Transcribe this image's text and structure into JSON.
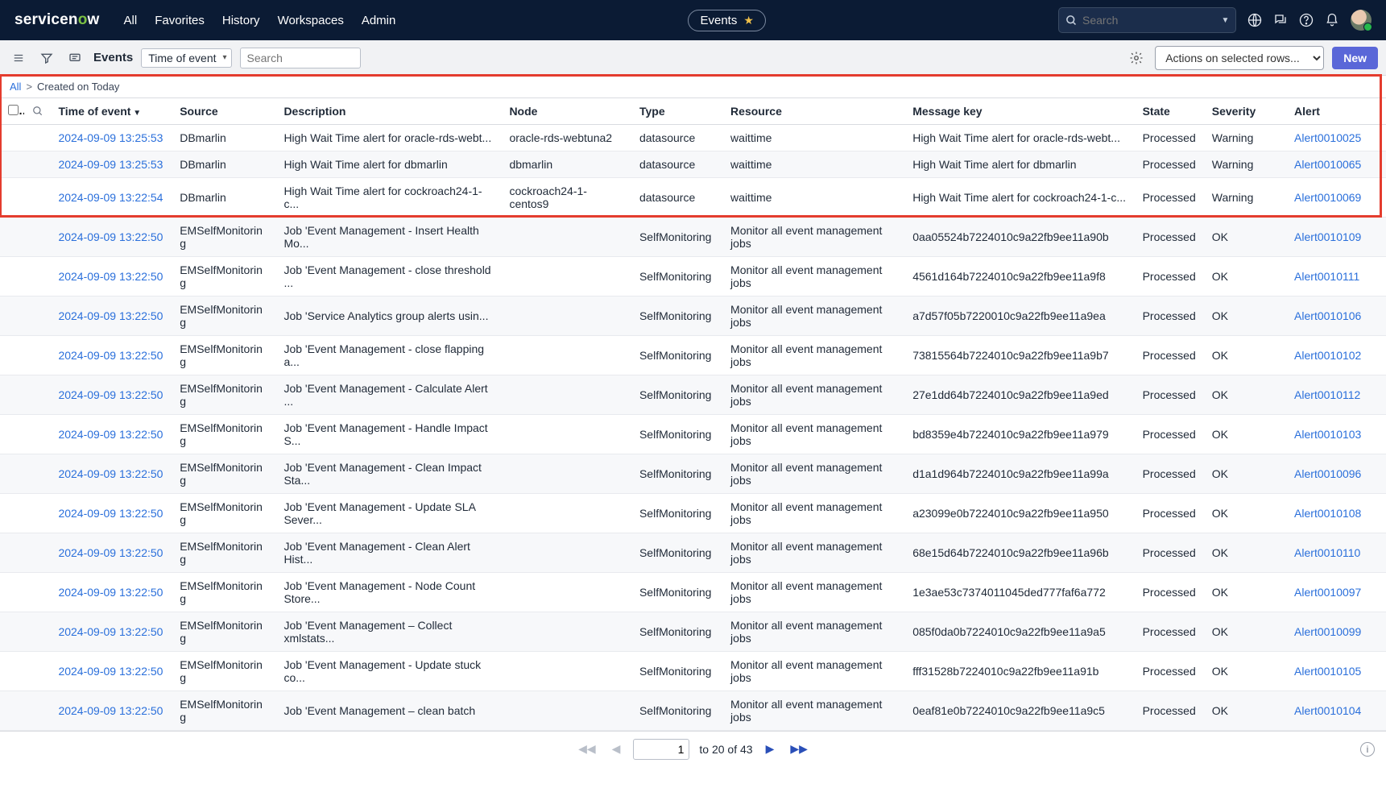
{
  "topnav": {
    "logo_prefix": "service",
    "logo_mid": "n",
    "logo_o": "o",
    "logo_suffix": "w",
    "items": [
      "All",
      "Favorites",
      "History",
      "Workspaces",
      "Admin"
    ],
    "pill_label": "Events",
    "search_placeholder": "Search"
  },
  "toolbar": {
    "label": "Events",
    "filter_field": "Time of event",
    "search_placeholder": "Search",
    "actions_label": "Actions on selected rows...",
    "new_label": "New"
  },
  "breadcrumb": {
    "all": "All",
    "sep": ">",
    "current": "Created on Today"
  },
  "columns": {
    "time": "Time of event",
    "source": "Source",
    "description": "Description",
    "node": "Node",
    "type": "Type",
    "resource": "Resource",
    "message_key": "Message key",
    "state": "State",
    "severity": "Severity",
    "alert": "Alert"
  },
  "rows": [
    {
      "time": "2024-09-09 13:25:53",
      "source": "DBmarlin",
      "description": "High Wait Time alert for oracle-rds-webt...",
      "node": "oracle-rds-webtuna2",
      "type": "datasource",
      "resource": "waittime",
      "message_key": "High Wait Time alert for oracle-rds-webt...",
      "state": "Processed",
      "severity": "Warning",
      "alert": "Alert0010025"
    },
    {
      "time": "2024-09-09 13:25:53",
      "source": "DBmarlin",
      "description": "High Wait Time alert for dbmarlin",
      "node": "dbmarlin",
      "type": "datasource",
      "resource": "waittime",
      "message_key": "High Wait Time alert for dbmarlin",
      "state": "Processed",
      "severity": "Warning",
      "alert": "Alert0010065"
    },
    {
      "time": "2024-09-09 13:22:54",
      "source": "DBmarlin",
      "description": "High Wait Time alert for cockroach24-1-c...",
      "node": "cockroach24-1-centos9",
      "type": "datasource",
      "resource": "waittime",
      "message_key": "High Wait Time alert for cockroach24-1-c...",
      "state": "Processed",
      "severity": "Warning",
      "alert": "Alert0010069"
    },
    {
      "time": "2024-09-09 13:22:50",
      "source": "EMSelfMonitoring",
      "description": "Job 'Event Management - Insert Health Mo...",
      "node": "",
      "type": "SelfMonitoring",
      "resource": "Monitor all event management jobs",
      "message_key": "0aa05524b7224010c9a22fb9ee11a90b",
      "state": "Processed",
      "severity": "OK",
      "alert": "Alert0010109"
    },
    {
      "time": "2024-09-09 13:22:50",
      "source": "EMSelfMonitoring",
      "description": "Job 'Event Management - close threshold ...",
      "node": "",
      "type": "SelfMonitoring",
      "resource": "Monitor all event management jobs",
      "message_key": "4561d164b7224010c9a22fb9ee11a9f8",
      "state": "Processed",
      "severity": "OK",
      "alert": "Alert0010111"
    },
    {
      "time": "2024-09-09 13:22:50",
      "source": "EMSelfMonitoring",
      "description": "Job 'Service Analytics group alerts usin...",
      "node": "",
      "type": "SelfMonitoring",
      "resource": "Monitor all event management jobs",
      "message_key": "a7d57f05b7220010c9a22fb9ee11a9ea",
      "state": "Processed",
      "severity": "OK",
      "alert": "Alert0010106"
    },
    {
      "time": "2024-09-09 13:22:50",
      "source": "EMSelfMonitoring",
      "description": "Job 'Event Management - close flapping a...",
      "node": "",
      "type": "SelfMonitoring",
      "resource": "Monitor all event management jobs",
      "message_key": "73815564b7224010c9a22fb9ee11a9b7",
      "state": "Processed",
      "severity": "OK",
      "alert": "Alert0010102"
    },
    {
      "time": "2024-09-09 13:22:50",
      "source": "EMSelfMonitoring",
      "description": "Job 'Event Management - Calculate Alert ...",
      "node": "",
      "type": "SelfMonitoring",
      "resource": "Monitor all event management jobs",
      "message_key": "27e1dd64b7224010c9a22fb9ee11a9ed",
      "state": "Processed",
      "severity": "OK",
      "alert": "Alert0010112"
    },
    {
      "time": "2024-09-09 13:22:50",
      "source": "EMSelfMonitoring",
      "description": "Job 'Event Management - Handle Impact S...",
      "node": "",
      "type": "SelfMonitoring",
      "resource": "Monitor all event management jobs",
      "message_key": "bd8359e4b7224010c9a22fb9ee11a979",
      "state": "Processed",
      "severity": "OK",
      "alert": "Alert0010103"
    },
    {
      "time": "2024-09-09 13:22:50",
      "source": "EMSelfMonitoring",
      "description": "Job 'Event Management - Clean Impact Sta...",
      "node": "",
      "type": "SelfMonitoring",
      "resource": "Monitor all event management jobs",
      "message_key": "d1a1d964b7224010c9a22fb9ee11a99a",
      "state": "Processed",
      "severity": "OK",
      "alert": "Alert0010096"
    },
    {
      "time": "2024-09-09 13:22:50",
      "source": "EMSelfMonitoring",
      "description": "Job 'Event Management - Update SLA Sever...",
      "node": "",
      "type": "SelfMonitoring",
      "resource": "Monitor all event management jobs",
      "message_key": "a23099e0b7224010c9a22fb9ee11a950",
      "state": "Processed",
      "severity": "OK",
      "alert": "Alert0010108"
    },
    {
      "time": "2024-09-09 13:22:50",
      "source": "EMSelfMonitoring",
      "description": "Job 'Event Management - Clean Alert Hist...",
      "node": "",
      "type": "SelfMonitoring",
      "resource": "Monitor all event management jobs",
      "message_key": "68e15d64b7224010c9a22fb9ee11a96b",
      "state": "Processed",
      "severity": "OK",
      "alert": "Alert0010110"
    },
    {
      "time": "2024-09-09 13:22:50",
      "source": "EMSelfMonitoring",
      "description": "Job 'Event Management - Node Count Store...",
      "node": "",
      "type": "SelfMonitoring",
      "resource": "Monitor all event management jobs",
      "message_key": "1e3ae53c7374011045ded777faf6a772",
      "state": "Processed",
      "severity": "OK",
      "alert": "Alert0010097"
    },
    {
      "time": "2024-09-09 13:22:50",
      "source": "EMSelfMonitoring",
      "description": "Job 'Event Management – Collect xmlstats...",
      "node": "",
      "type": "SelfMonitoring",
      "resource": "Monitor all event management jobs",
      "message_key": "085f0da0b7224010c9a22fb9ee11a9a5",
      "state": "Processed",
      "severity": "OK",
      "alert": "Alert0010099"
    },
    {
      "time": "2024-09-09 13:22:50",
      "source": "EMSelfMonitoring",
      "description": "Job 'Event Management - Update stuck co...",
      "node": "",
      "type": "SelfMonitoring",
      "resource": "Monitor all event management jobs",
      "message_key": "fff31528b7224010c9a22fb9ee11a91b",
      "state": "Processed",
      "severity": "OK",
      "alert": "Alert0010105"
    },
    {
      "time": "2024-09-09 13:22:50",
      "source": "EMSelfMonitoring",
      "description": "Job 'Event Management – clean batch",
      "node": "",
      "type": "SelfMonitoring",
      "resource": "Monitor all event management jobs",
      "message_key": "0eaf81e0b7224010c9a22fb9ee11a9c5",
      "state": "Processed",
      "severity": "OK",
      "alert": "Alert0010104"
    }
  ],
  "pagination": {
    "page_input": "1",
    "range_text": "to 20 of 43"
  }
}
